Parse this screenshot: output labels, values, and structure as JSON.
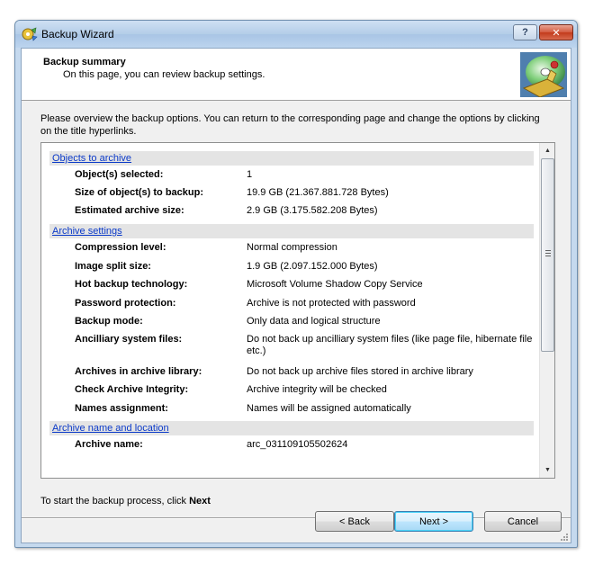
{
  "window": {
    "title": "Backup Wizard",
    "help_label": "?",
    "close_label": "✕"
  },
  "header": {
    "title": "Backup summary",
    "subtitle": "On this page, you can review backup settings."
  },
  "description": "Please overview the backup options. You can return to the corresponding page and change the options by clicking on the title hyperlinks.",
  "summary": {
    "sections": [
      {
        "title": "Objects to archive",
        "rows": [
          {
            "label": "Object(s) selected:",
            "value": "1"
          },
          {
            "label": "Size of object(s) to backup:",
            "value": "19.9 GB (21.367.881.728 Bytes)"
          },
          {
            "label": "Estimated archive size:",
            "value": "2.9 GB (3.175.582.208 Bytes)"
          }
        ]
      },
      {
        "title": "Archive settings",
        "rows": [
          {
            "label": "Compression level:",
            "value": "Normal compression"
          },
          {
            "label": "Image split size:",
            "value": "1.9 GB (2.097.152.000 Bytes)"
          },
          {
            "label": "Hot backup technology:",
            "value": "Microsoft Volume Shadow Copy Service"
          },
          {
            "label": "Password protection:",
            "value": "Archive is not protected with password"
          },
          {
            "label": "Backup mode:",
            "value": "Only data and logical structure"
          },
          {
            "label": "Ancilliary system files:",
            "value": "Do not back up ancilliary system files (like page file, hibernate file etc.)"
          },
          {
            "label": "Archives in archive library:",
            "value": "Do not back up archive files stored in archive library"
          },
          {
            "label": "Check Archive Integrity:",
            "value": "Archive integrity will be checked"
          },
          {
            "label": "Names assignment:",
            "value": "Names will be assigned automatically"
          }
        ]
      },
      {
        "title": "Archive name and location",
        "rows": [
          {
            "label": "Archive name:",
            "value": "arc_031109105502624"
          }
        ]
      }
    ],
    "scroll_position": 0
  },
  "footer": {
    "instruction": "To start the backup process, click ",
    "instruction_bold": "Next"
  },
  "buttons": {
    "back": "< Back",
    "next": "Next >",
    "cancel": "Cancel"
  }
}
